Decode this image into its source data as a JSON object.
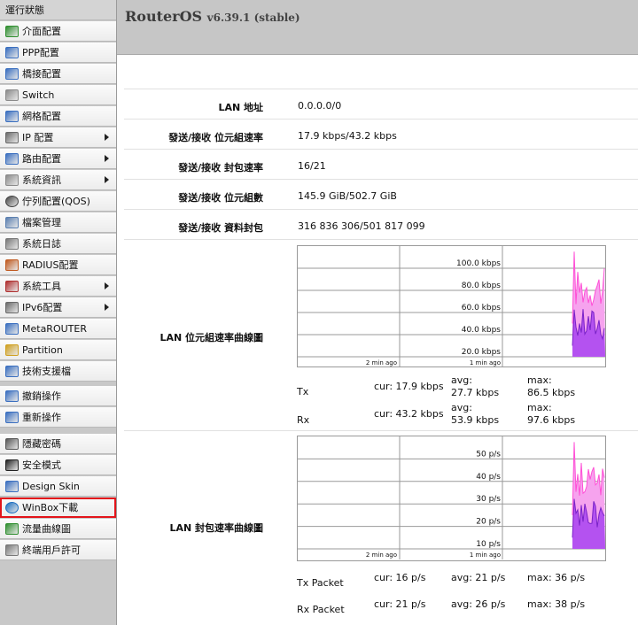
{
  "sidebar": {
    "header": "運行狀態",
    "items": [
      {
        "label": "介面配置",
        "icon": "interface-icon",
        "arrow": false
      },
      {
        "label": "PPP配置",
        "icon": "ppp-icon",
        "arrow": false
      },
      {
        "label": "橋接配置",
        "icon": "bridge-icon",
        "arrow": false
      },
      {
        "label": "Switch",
        "icon": "switch-icon",
        "arrow": false
      },
      {
        "label": "網格配置",
        "icon": "mesh-icon",
        "arrow": false
      },
      {
        "label": "IP 配置",
        "icon": "ip-icon",
        "arrow": true
      },
      {
        "label": "路由配置",
        "icon": "routing-icon",
        "arrow": true
      },
      {
        "label": "系統資訊",
        "icon": "system-gear-icon",
        "arrow": true
      },
      {
        "label": "佇列配置(QOS)",
        "icon": "queue-icon",
        "arrow": false
      },
      {
        "label": "檔案管理",
        "icon": "files-icon",
        "arrow": false
      },
      {
        "label": "系統日誌",
        "icon": "log-icon",
        "arrow": false
      },
      {
        "label": "RADIUS配置",
        "icon": "radius-icon",
        "arrow": false
      },
      {
        "label": "系統工具",
        "icon": "tools-icon",
        "arrow": true
      },
      {
        "label": "IPv6配置",
        "icon": "ipv6-icon",
        "arrow": true
      },
      {
        "label": "MetaROUTER",
        "icon": "metarouter-icon",
        "arrow": false
      },
      {
        "label": "Partition",
        "icon": "partition-icon",
        "arrow": false
      },
      {
        "label": "技術支援檔",
        "icon": "support-file-icon",
        "arrow": false
      },
      {
        "label": "撤銷操作",
        "icon": "undo-icon",
        "arrow": false
      },
      {
        "label": "重新操作",
        "icon": "redo-icon",
        "arrow": false
      },
      {
        "label": "隱藏密碼",
        "icon": "hide-password-icon",
        "arrow": false
      },
      {
        "label": "安全模式",
        "icon": "safe-mode-icon",
        "arrow": false
      },
      {
        "label": "Design Skin",
        "icon": "design-skin-icon",
        "arrow": false
      },
      {
        "label": "WinBox下載",
        "icon": "winbox-icon",
        "arrow": false
      },
      {
        "label": "流量曲線圖",
        "icon": "graph-icon",
        "arrow": false
      },
      {
        "label": "終端用戶許可",
        "icon": "license-icon",
        "arrow": false
      }
    ]
  },
  "header": {
    "brand": "RouterOS",
    "version": "v6.39.1 (stable)"
  },
  "info_rows": [
    {
      "label": "LAN 地址",
      "value": "0.0.0.0/0"
    },
    {
      "label": "發送/接收 位元組速率",
      "value": "17.9 kbps/43.2 kbps"
    },
    {
      "label": "發送/接收 封包速率",
      "value": "16/21"
    },
    {
      "label": "發送/接收 位元組數",
      "value": "145.9 GiB/502.7 GiB"
    },
    {
      "label": "發送/接收 資料封包",
      "value": "316 836 306/501 817 099"
    }
  ],
  "bitrate_graph": {
    "label": "LAN 位元組速率曲線圖",
    "y_ticks": [
      "100.0 kbps",
      "80.0 kbps",
      "60.0 kbps",
      "40.0 kbps",
      "20.0 kbps"
    ],
    "x_ticks": [
      "2 min ago",
      "1 min ago"
    ],
    "tx": {
      "name": "Tx",
      "cur": "cur: 17.9 kbps",
      "avg_label": "avg:",
      "avg": "27.7 kbps",
      "max_label": "max:",
      "max": "86.5 kbps"
    },
    "rx": {
      "name": "Rx",
      "cur": "cur: 43.2 kbps",
      "avg_label": "avg:",
      "avg": "53.9 kbps",
      "max_label": "max:",
      "max": "97.6 kbps"
    }
  },
  "packet_graph": {
    "label": "LAN 封包速率曲線圖",
    "y_ticks": [
      "50 p/s",
      "40 p/s",
      "30 p/s",
      "20 p/s",
      "10 p/s"
    ],
    "x_ticks": [
      "2 min ago",
      "1 min ago"
    ],
    "tx": {
      "name": "Tx Packet",
      "cur": "cur: 16 p/s",
      "avg": "avg: 21 p/s",
      "max": "max: 36 p/s"
    },
    "rx": {
      "name": "Rx Packet",
      "cur": "cur: 21 p/s",
      "avg": "avg: 26 p/s",
      "max": "max: 38 p/s"
    }
  },
  "colors": {
    "rx_fill": "#b452f0",
    "tx_fill": "#f6a3ee",
    "tx_line": "#ff4fd6",
    "rx_line": "#7a22c8",
    "highlight_border": "#e3141a"
  }
}
